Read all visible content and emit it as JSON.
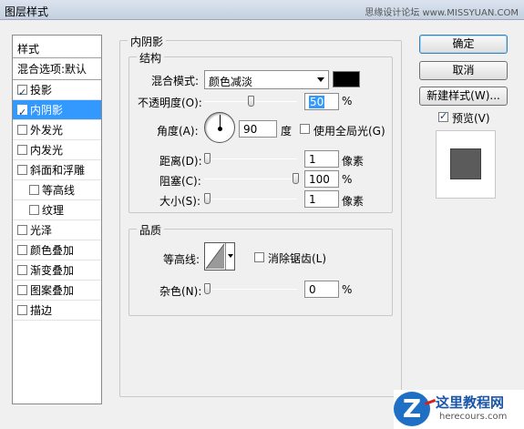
{
  "window": {
    "title": "图层样式",
    "watermark": "思缘设计论坛 www.MISSYUAN.COM"
  },
  "style_list": {
    "header": "样式",
    "blend_options": "混合选项:默认",
    "items": [
      {
        "label": "投影",
        "checked": true,
        "selected": false,
        "indent": false
      },
      {
        "label": "内阴影",
        "checked": true,
        "selected": true,
        "indent": false
      },
      {
        "label": "外发光",
        "checked": false,
        "selected": false,
        "indent": false
      },
      {
        "label": "内发光",
        "checked": false,
        "selected": false,
        "indent": false
      },
      {
        "label": "斜面和浮雕",
        "checked": false,
        "selected": false,
        "indent": false
      },
      {
        "label": "等高线",
        "checked": false,
        "selected": false,
        "indent": true
      },
      {
        "label": "纹理",
        "checked": false,
        "selected": false,
        "indent": true
      },
      {
        "label": "光泽",
        "checked": false,
        "selected": false,
        "indent": false
      },
      {
        "label": "颜色叠加",
        "checked": false,
        "selected": false,
        "indent": false
      },
      {
        "label": "渐变叠加",
        "checked": false,
        "selected": false,
        "indent": false
      },
      {
        "label": "图案叠加",
        "checked": false,
        "selected": false,
        "indent": false
      },
      {
        "label": "描边",
        "checked": false,
        "selected": false,
        "indent": false
      }
    ]
  },
  "inner_shadow": {
    "section_title": "内阴影",
    "structure": {
      "legend": "结构",
      "blend_mode_label": "混合模式:",
      "blend_mode_value": "颜色减淡",
      "color": "#000000",
      "opacity_label": "不透明度(O):",
      "opacity_value": "50",
      "opacity_unit": "%",
      "angle_label": "角度(A):",
      "angle_value": "90",
      "angle_unit": "度",
      "global_light_label": "使用全局光(G)",
      "global_light_checked": false,
      "distance_label": "距离(D):",
      "distance_value": "1",
      "distance_unit": "像素",
      "choke_label": "阻塞(C):",
      "choke_value": "100",
      "choke_unit": "%",
      "size_label": "大小(S):",
      "size_value": "1",
      "size_unit": "像素"
    },
    "quality": {
      "legend": "品质",
      "contour_label": "等高线:",
      "anti_alias_label": "消除锯齿(L)",
      "anti_alias_checked": false,
      "noise_label": "杂色(N):",
      "noise_value": "0",
      "noise_unit": "%"
    }
  },
  "buttons": {
    "ok": "确定",
    "cancel": "取消",
    "new_style": "新建样式(W)...",
    "preview_label": "预览(V)",
    "preview_checked": true
  },
  "logo": {
    "cn": "这里教程网",
    "en": "herecours.com"
  }
}
